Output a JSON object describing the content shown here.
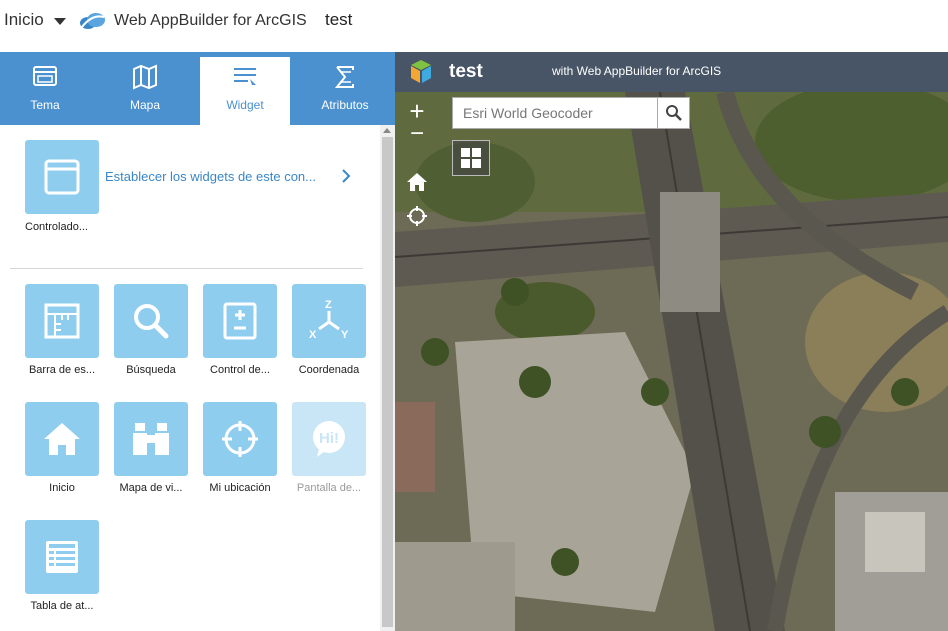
{
  "topbar": {
    "home_label": "Inicio",
    "brand_label": "Web AppBuilder for ArcGIS",
    "app_name": "test"
  },
  "tabs": [
    {
      "label": "Tema",
      "icon": "theme-icon"
    },
    {
      "label": "Mapa",
      "icon": "map-icon"
    },
    {
      "label": "Widget",
      "icon": "widget-icon",
      "active": true
    },
    {
      "label": "Atributos",
      "icon": "attributes-icon"
    }
  ],
  "panel": {
    "controller_label": "Controlado...",
    "set_widgets_link": "Establecer los widgets de este con...",
    "widgets": [
      {
        "label": "Barra de es...",
        "icon": "scalebar-icon"
      },
      {
        "label": "Búsqueda",
        "icon": "search-icon"
      },
      {
        "label": "Control de...",
        "icon": "layer-control-icon"
      },
      {
        "label": "Coordenada",
        "icon": "coordinate-icon"
      },
      {
        "label": "Inicio",
        "icon": "home-icon"
      },
      {
        "label": "Mapa de vi...",
        "icon": "binoculars-icon"
      },
      {
        "label": "Mi ubicación",
        "icon": "locate-icon"
      },
      {
        "label": "Pantalla de...",
        "icon": "splash-icon",
        "disabled": true
      },
      {
        "label": "Tabla de at...",
        "icon": "table-icon"
      }
    ]
  },
  "map": {
    "title": "test",
    "subtitle": "with Web AppBuilder for ArcGIS",
    "search_placeholder": "Esri World Geocoder",
    "zoom_in": "+",
    "zoom_out": "−"
  },
  "colors": {
    "tab_bar": "#4b90cf",
    "tile": "#8fcdef",
    "map_header": "#485566",
    "link": "#3a87c8"
  }
}
